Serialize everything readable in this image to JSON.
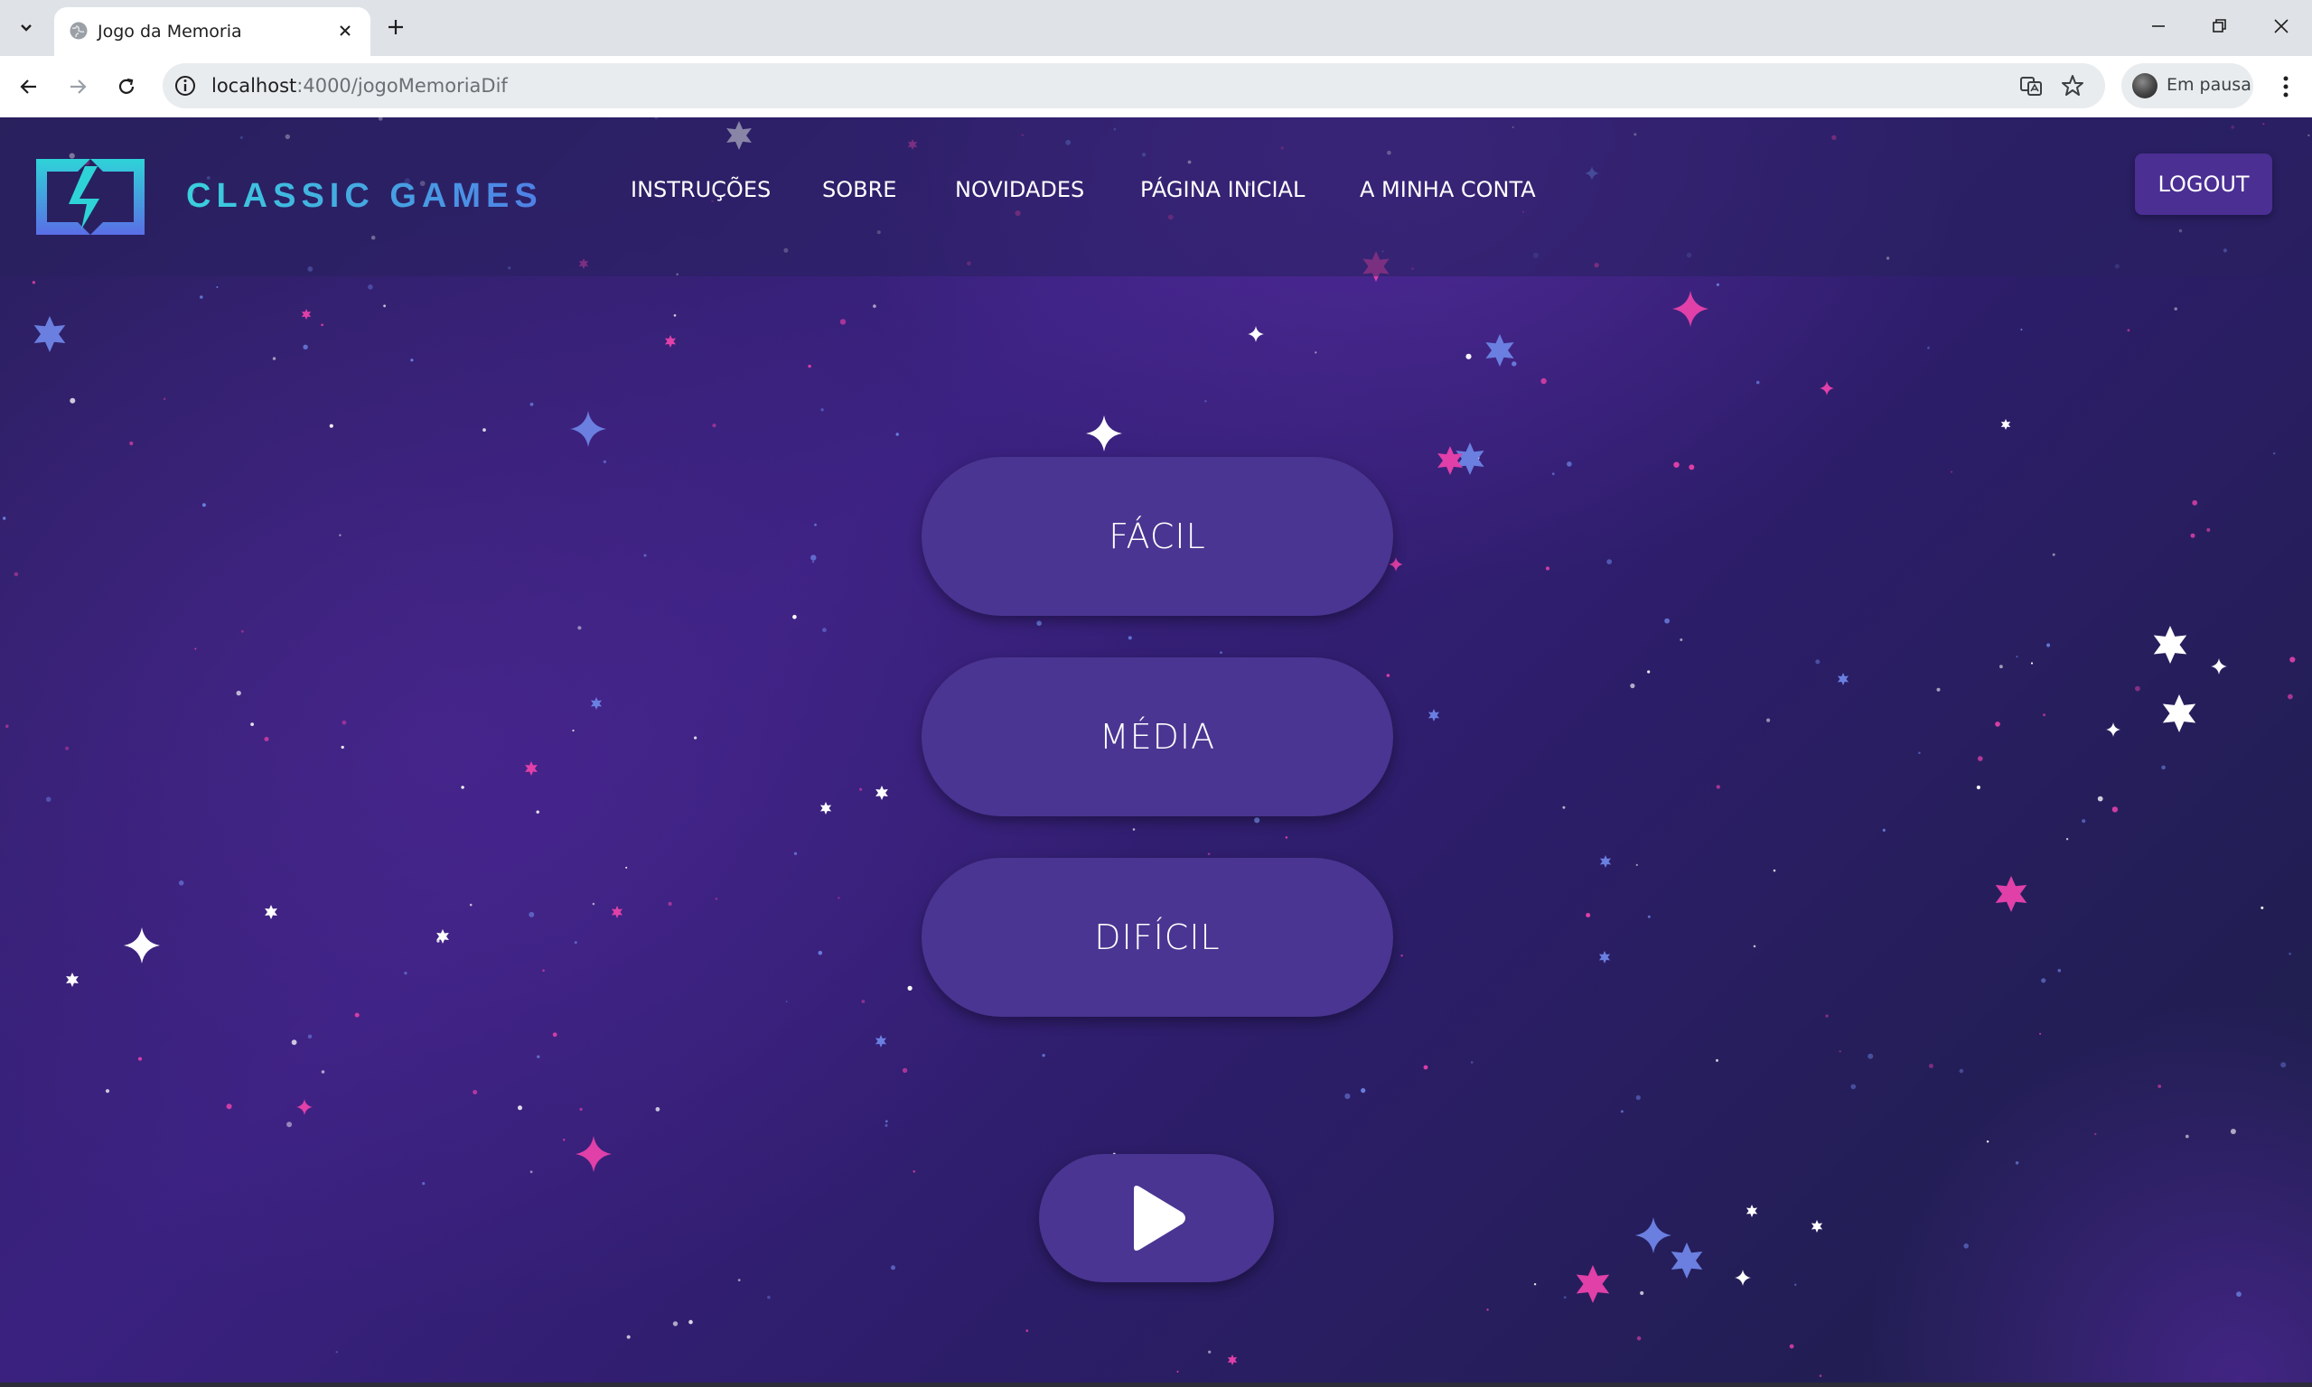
{
  "browser": {
    "tab_title": "Jogo da Memoria",
    "url_host": "localhost",
    "url_path": ":4000/jogoMemoriaDif",
    "profile_label": "Em pausa"
  },
  "header": {
    "brand": "CLASSIC GAMES",
    "nav": [
      "INSTRUÇÕES",
      "SOBRE",
      "NOVIDADES",
      "PÁGINA INICIAL",
      "A MINHA CONTA"
    ],
    "logout": "LOGOUT"
  },
  "difficulty": {
    "easy": "FÁCIL",
    "medium": "MÉDIA",
    "hard": "DIFÍCIL"
  },
  "colors": {
    "accent": "#4a3592",
    "logout_bg": "#4b2f93",
    "brand_gradient_start": "#3ad0dd",
    "brand_gradient_end": "#4f7fe6",
    "star_pink": "#e040a8",
    "star_blue": "#6a7fe0",
    "star_white": "#ffffff"
  },
  "icons": {
    "play": "play-icon",
    "logo": "classic-games-logo-icon"
  }
}
